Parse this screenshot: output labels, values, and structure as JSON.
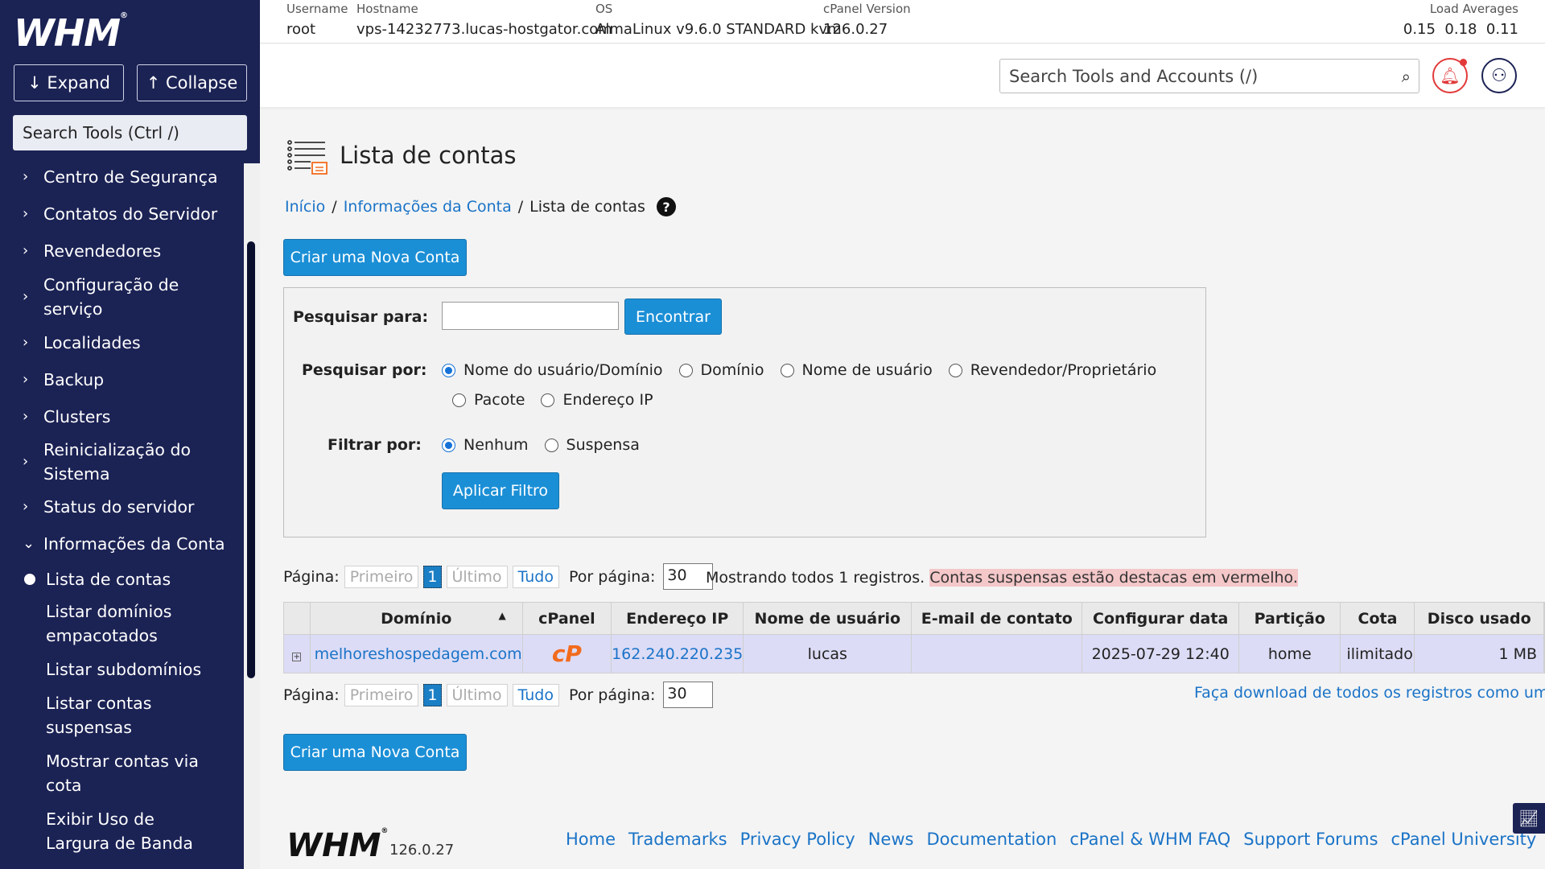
{
  "app": {
    "logo": "WHM",
    "logo_mark": "®"
  },
  "sidebar": {
    "expand_label": "↓ Expand",
    "collapse_label": "↑ Collapse",
    "search_placeholder": "Search Tools (Ctrl /)",
    "items": [
      {
        "label": "Centro de Segurança"
      },
      {
        "label": "Contatos do Servidor"
      },
      {
        "label": "Revendedores"
      },
      {
        "label": "Configuração de serviço"
      },
      {
        "label": "Localidades"
      },
      {
        "label": "Backup"
      },
      {
        "label": "Clusters"
      },
      {
        "label": "Reinicialização do Sistema"
      },
      {
        "label": "Status do servidor"
      },
      {
        "label": "Informações da Conta"
      }
    ],
    "sub_items": [
      {
        "label": "Lista de contas"
      },
      {
        "label": "Listar domínios empacotados"
      },
      {
        "label": "Listar subdomínios"
      },
      {
        "label": "Listar contas suspensas"
      },
      {
        "label": "Mostrar contas via cota"
      },
      {
        "label": "Exibir Uso de Largura de Banda"
      }
    ]
  },
  "infobar": {
    "username_label": "Username",
    "username": "root",
    "hostname_label": "Hostname",
    "hostname": "vps-14232773.lucas-hostgator.com",
    "os_label": "OS",
    "os": "AlmaLinux v9.6.0 STANDARD kvm",
    "cpanel_label": "cPanel Version",
    "cpanel": "126.0.27",
    "load_label": "Load Averages",
    "load": "0.15  0.18  0.11"
  },
  "header": {
    "search_placeholder": "Search Tools and Accounts (/)"
  },
  "page": {
    "title": "Lista de contas",
    "breadcrumb": {
      "home": "Início",
      "section": "Informações da Conta",
      "current": "Lista de contas",
      "sep": "/"
    },
    "create_label": "Criar uma Nova Conta"
  },
  "search": {
    "search_for_label": "Pesquisar para:",
    "find_label": "Encontrar",
    "search_by_label": "Pesquisar por:",
    "search_by_options": [
      "Nome do usuário/Domínio",
      "Domínio",
      "Nome de usuário",
      "Revendedor/Proprietário",
      "Pacote",
      "Endereço IP"
    ],
    "filter_label": "Filtrar por:",
    "filter_options": [
      "Nenhum",
      "Suspensa"
    ],
    "apply_label": "Aplicar Filtro"
  },
  "pager": {
    "page_label": "Página:",
    "first": "Primeiro",
    "current": "1",
    "last": "Último",
    "all": "Tudo",
    "per_page_label": "Por página:",
    "per_page": "30"
  },
  "status": {
    "showing": "Mostrando todos 1 registros.",
    "suspended_note": "Contas suspensas estão destacas em vermelho."
  },
  "table": {
    "headers": [
      "Domínio",
      "cPanel",
      "Endereço IP",
      "Nome de usuário",
      "E-mail de contato",
      "Configurar data",
      "Partição",
      "Cota",
      "Disco usado"
    ],
    "sort_indicator": "▲",
    "rows": [
      {
        "expand": "+",
        "domain": "melhoreshospedagem.com",
        "cpanel": "cP",
        "ip": "162.240.220.235",
        "user": "lucas",
        "email": "",
        "date": "2025-07-29 12:40",
        "partition": "home",
        "quota": "ilimitado",
        "disk": "1 MB"
      }
    ]
  },
  "download_label": "Faça download de todos os registros como um arq",
  "footer": {
    "logo": "WHM",
    "version": "126.0.27",
    "links": [
      "Home",
      "Trademarks",
      "Privacy Policy",
      "News",
      "Documentation",
      "cPanel & WHM FAQ",
      "Support Forums",
      "cPanel University"
    ]
  }
}
